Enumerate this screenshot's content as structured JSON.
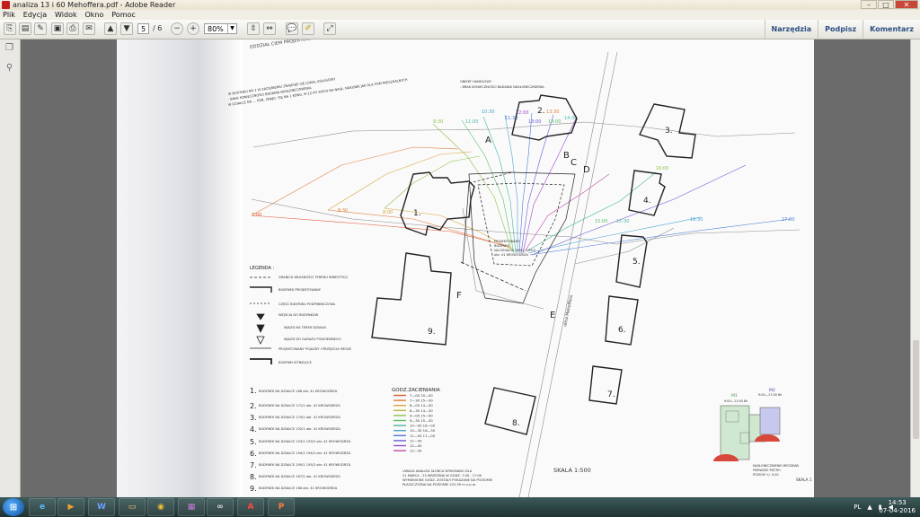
{
  "window": {
    "title": "analiza 13 i 60 Mehoffera.pdf - Adobe Reader"
  },
  "menu": [
    "Plik",
    "Edycja",
    "Widok",
    "Okno",
    "Pomoc"
  ],
  "toolbar": {
    "page_current": "5",
    "page_total": "/ 6",
    "zoom": "80%",
    "links": [
      "Narzędzia",
      "Podpisz",
      "Komentarz"
    ]
  },
  "drawing": {
    "title": "ODDZIAŁ CIEM PROJEKTOWANEGO BUDYNKU",
    "notes_left": [
      "W BUDYNKU NR 2 W ZACIENIENIU ZNAJDUJE SIĘ LOKAL USŁUGOWY",
      "- BRAK KONIECZNOŚCI BADANIA NASŁONECZNIENIA",
      "W DZIAŁCE NR ... PON. ZNAJD. SIĘ NA 1 KONG. M 2Z PO WSCH NA NASŁ. NARUNKI JAK DLA POM MIESZKALNYCH"
    ],
    "notes_top": [
      "OBIEKT HANDLOWY",
      "- BRAK KONIECZNOŚCI BADANIA NASŁONECZNIENIA"
    ],
    "times": [
      "7:00",
      "8:30",
      "8:00",
      "9:30",
      "10:30",
      "11:00",
      "11:30",
      "12:00",
      "13:00",
      "13:30",
      "14:00",
      "14:30",
      "15:00",
      "15:30",
      "16:00",
      "16:30",
      "17:00",
      "16:30"
    ],
    "point_labels": [
      "A",
      "B",
      "C",
      "D",
      "E",
      "F"
    ],
    "buildings": [
      "1.",
      "2.",
      "3.",
      "4.",
      "5.",
      "6.",
      "7.",
      "8.",
      "9."
    ],
    "street": "ulica Mehoffera",
    "project_label": [
      "PROJEKTOWANY",
      "BUDYNEK",
      "NA DZIAŁCE 169/2, 195/2",
      "obr. 41 KROWODRZA"
    ],
    "legend_title": "LEGENDA :",
    "legend_items": [
      "GRANICA WŁASNOŚCI TERENU INWESTYCJI",
      "BUDYNEK PROJEKTOWANY",
      "CZĘŚĆ BUDYNKU PODPIWNICZONA",
      "WEJŚCIA DO BUDYNKÓW",
      "WJAZD NA TEREN DZIAŁKI",
      "WJAZD DO GARAŻU PODZIEMNEGO",
      "PROJEKTOWANY POJAZDY I PRZEJŚCIA PIESZE",
      "BUDYNKI ISTNIEJĄCE"
    ],
    "building_list": [
      "BUDYNEK NA DZIAŁCE 168 obr. 41 KROWODRZA",
      "BUDYNEK NA DZIAŁCE 171/1 obr. 41 KROWODRZA",
      "BUDYNEK NA DZIAŁCE 174/2 obr. 41 KROWODRZA",
      "BUDYNEK NA DZIAŁCE 192/1 obr. 41 KROWODRZA",
      "BUDYNEK NA DZIAŁCE 193/1 193/2 obr. 41 KROWODRZA",
      "BUDYNEK NA DZIAŁCE 194/1 194/2 obr. 41 KROWODRZA",
      "BUDYNEK NA DZIAŁCE 195/1 195/2 obr. 41 KROWODRZA",
      "BUDYNEK NA DZIAŁCE 167/2 obr. 41 KROWODRZA",
      "BUDYNEK NA DZIAŁCE 166 obr. 41 KROWODRZA"
    ],
    "shade_title": "GODZ.ZACIENIANIA",
    "shade_rows": [
      {
        "t": "7—00   15—00",
        "c": "#e05a3a"
      },
      {
        "t": "7—30   15—30",
        "c": "#e07b3a"
      },
      {
        "t": "8—00   14—00",
        "c": "#d8a53c"
      },
      {
        "t": "8—30   14—30",
        "c": "#b8b83c"
      },
      {
        "t": "9—00   15—00",
        "c": "#8fc24a"
      },
      {
        "t": "9—30   15—30",
        "c": "#5ac06a"
      },
      {
        "t": "10—00  16—00",
        "c": "#46b8a0"
      },
      {
        "t": "10—30  16—30",
        "c": "#4aa0d0"
      },
      {
        "t": "11—00  17—00",
        "c": "#4a7ad8"
      },
      {
        "t": "11—30",
        "c": "#6a5ad8"
      },
      {
        "t": "12—00",
        "c": "#9a4ad0"
      },
      {
        "t": "12—30",
        "c": "#c04aa8"
      }
    ],
    "analysis_note": [
      "UWAGA ANALIZA SŁOŃCA WYKONANO DLA",
      "21 MARCA - 23 WRZEŚNIA W GODZ. 7:00 - 17:00",
      "WYMIENIONE GODZ. ZOSTAŁY POKAZANE NA POZIOMIE",
      "PŁASZCZYZNA NA POZIOMIE 222,99 m n.p.m."
    ],
    "scale": "SKALA 1:500",
    "inset_labels": [
      "M1",
      "M2",
      "9:00—11:00 8h",
      "9:00—17:00 8h"
    ],
    "inset_note": [
      "NASŁONECZNIENIE MIESZKAŃ",
      "PIERWSZE PIĘTRO",
      "POZIOM +/- 0,00"
    ],
    "inset_scale": "SKALA 1"
  },
  "taskbar": {
    "apps": [
      "IE",
      "media",
      "word",
      "folder",
      "chrome",
      "winrar",
      "share",
      "acrobat",
      "ppt"
    ],
    "lang": "PL",
    "time": "14:53",
    "date": "07-04-2016"
  }
}
